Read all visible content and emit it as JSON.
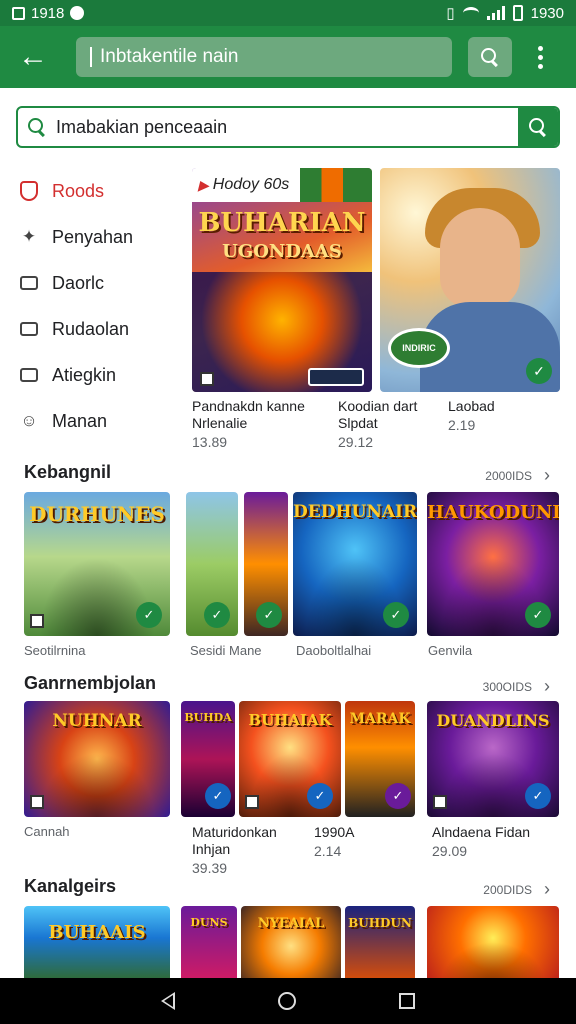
{
  "status": {
    "time_left": "1918",
    "time_right": "1930"
  },
  "appbar": {
    "search_value": "Inbtakentile nain"
  },
  "search2": {
    "value": "Imabakian penceaain"
  },
  "sidebar": {
    "items": [
      {
        "label": "Roods",
        "icon": "shield-icon"
      },
      {
        "label": "Penyahan",
        "icon": "sparkle-icon"
      },
      {
        "label": "Daorlc",
        "icon": "gamepad-icon"
      },
      {
        "label": "Rudaolan",
        "icon": "calendar-icon"
      },
      {
        "label": "Atiegkin",
        "icon": "chat-icon"
      },
      {
        "label": "Manan",
        "icon": "emoji-icon"
      }
    ]
  },
  "featured": [
    {
      "strip_text": "Hodoy 60s",
      "title": "BUHARIAN",
      "subtitle": "UGONDAAS",
      "name": "Pandnakdn kanne Nrlenalie",
      "price": "13.89"
    },
    {
      "badge": "INDIRIC",
      "name": "Koodian dart Slpdat",
      "price": "29.12"
    },
    {
      "name": "Laobad",
      "price": "2.19"
    }
  ],
  "sections": [
    {
      "title": "Kebangnil",
      "more": "2000IDS",
      "tiles": [
        {
          "title": "DURHUNES",
          "caption": "Seotilrnina"
        },
        {
          "title": "",
          "caption": ""
        },
        {
          "title": "",
          "caption": "Sesidi Mane"
        },
        {
          "title": "DEDHUNAIR",
          "caption": "Daoboltlalhai"
        },
        {
          "title": "HAUKODUNI",
          "caption": "Genvila"
        }
      ]
    },
    {
      "title": "Ganrnembjolan",
      "more": "300OIDS",
      "tiles": [
        {
          "title": "NUHNAR",
          "caption": "Cannah"
        },
        {
          "title": "BUHDA",
          "caption": ""
        },
        {
          "title": "BUHAIAK",
          "caption": ""
        },
        {
          "title": "MARAK",
          "caption": ""
        },
        {
          "title": "DUANDLINS",
          "caption": ""
        }
      ],
      "items": [
        {
          "name": "Maturidonkan Inhjan",
          "price": "39.39"
        },
        {
          "name": "1990A",
          "price": "2.14"
        },
        {
          "name": "Alndaena Fidan",
          "price": "29.09"
        }
      ]
    },
    {
      "title": "Kanalgeirs",
      "more": "200DIDS",
      "tiles": [
        {
          "title": "BUHAAIS"
        },
        {
          "title": "DUNS"
        },
        {
          "title": "NYEAIAL"
        },
        {
          "title": "BUHDUN"
        },
        {
          "title": ""
        }
      ]
    }
  ]
}
